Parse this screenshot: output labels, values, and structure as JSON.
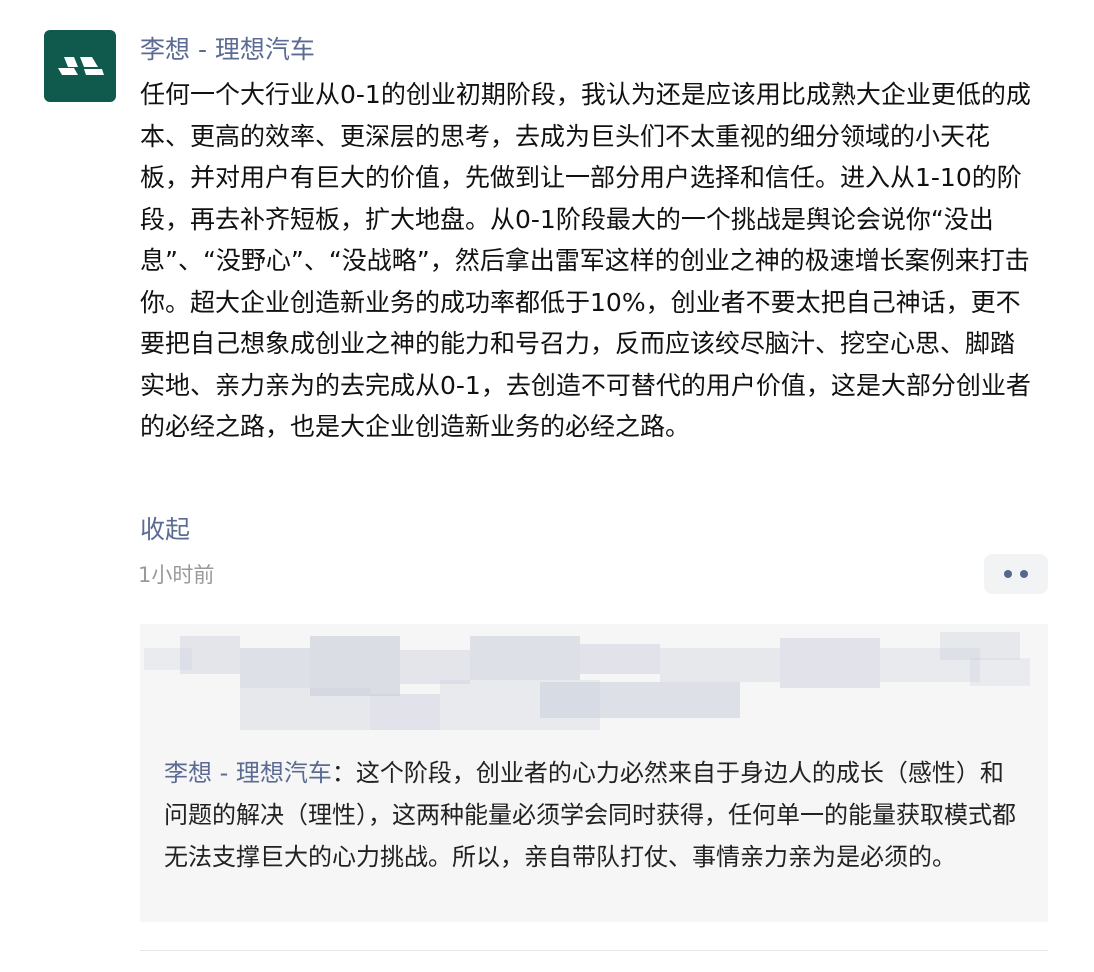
{
  "post": {
    "author": "李想 - 理想汽车",
    "avatar_icon": "li-auto-logo-icon",
    "avatar_color": "#0f5a4c",
    "content": "任何一个大行业从0-1的创业初期阶段，我认为还是应该用比成熟大企业更低的成本、更高的效率、更深层的思考，去成为巨头们不太重视的细分领域的小天花板，并对用户有巨大的价值，先做到让一部分用户选择和信任。进入从1-10的阶段，再去补齐短板，扩大地盘。从0-1阶段最大的一个挑战是舆论会说你“没出息”、“没野心”、“没战略”，然后拿出雷军这样的创业之神的极速增长案例来打击你。超大企业创造新业务的成功率都低于10%，创业者不要太把自己神话，更不要把自己想象成创业之神的能力和号召力，反而应该绞尽脑汁、挖空心思、脚踏实地、亲力亲为的去完成从0-1，去创造不可替代的用户价值，这是大部分创业者的必经之路，也是大企业创造新业务的必经之路。",
    "collapse_label": "收起",
    "time": "1小时前",
    "more_icon": "more-dots-icon"
  },
  "comments": {
    "blurred_icon": "blurred-likes-row",
    "items": [
      {
        "author": "李想 - 理想汽车",
        "separator": "：",
        "text": "这个阶段，创业者的心力必然来自于身边人的成长（感性）和问题的解决（理性），这两种能量必须学会同时获得，任何单一的能量获取模式都无法支撑巨大的心力挑战。所以，亲自带队打仗、事情亲力亲为是必须的。"
      }
    ]
  },
  "colors": {
    "link": "#5b6b93",
    "time": "#9a9a9a",
    "comment_bg": "#f6f6f6",
    "more_btn_bg": "#f2f3f5"
  }
}
